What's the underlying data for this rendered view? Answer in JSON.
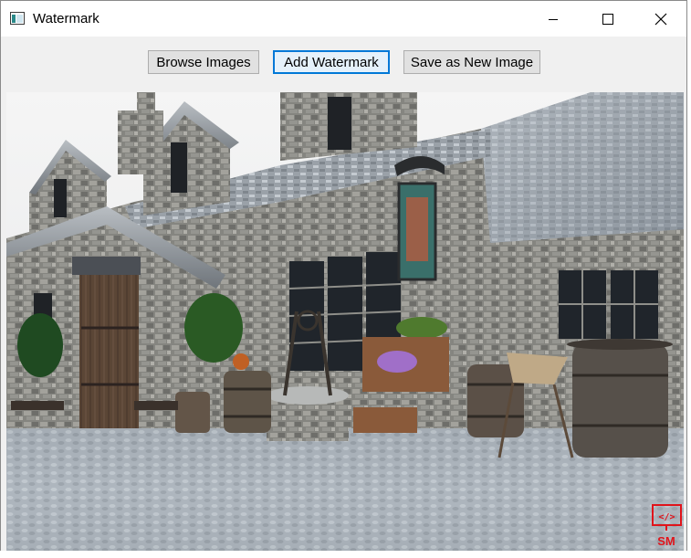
{
  "window": {
    "title": "Watermark",
    "icon": "app-window-icon"
  },
  "titlebar_controls": {
    "minimize_icon": "minimize-icon",
    "maximize_icon": "maximize-icon",
    "close_icon": "close-icon"
  },
  "toolbar": {
    "browse_label": "Browse Images",
    "add_watermark_label": "Add Watermark",
    "save_label": "Save as New Image"
  },
  "image": {
    "description_icon": "scene-image",
    "watermark": {
      "logo_icon": "code-brackets-icon",
      "text": "SM",
      "color": "#e0141b"
    }
  },
  "colors": {
    "accent": "#0078d7",
    "window_bg": "#f0f0f0",
    "button_bg": "#e1e1e1"
  }
}
